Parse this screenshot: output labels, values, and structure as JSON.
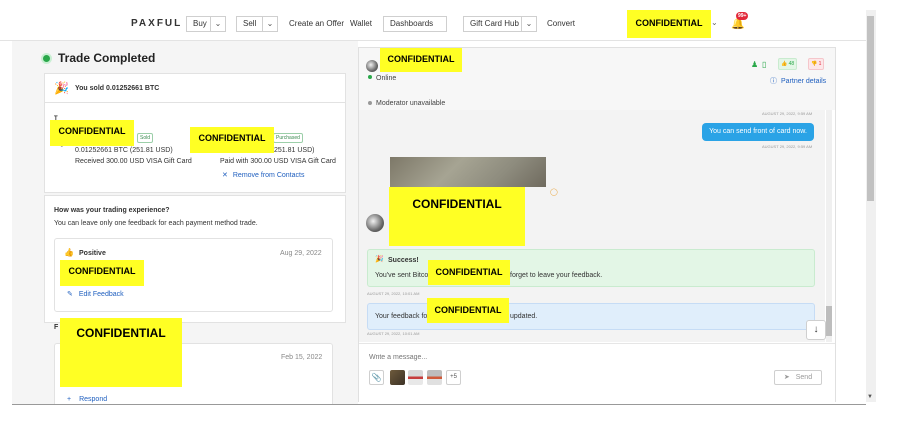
{
  "nav": {
    "logo": "PAXFUL",
    "buy": "Buy",
    "sell": "Sell",
    "create_offer": "Create an Offer",
    "wallet": "Wallet",
    "dashboards": "Dashboards",
    "gift_card_hub": "Gift Card Hub",
    "convert": "Convert",
    "user": "CONFIDENTIAL",
    "notif_count": "99+"
  },
  "left": {
    "title": "Trade Completed",
    "sold_line": "You sold 0.01252661 BTC",
    "redact_name1": "CONFIDENTIAL",
    "redact_name2": "CONFIDENTIAL",
    "sold_pill": "Sold",
    "purchased_pill": "Purchased",
    "sold_amount": "0.01252661 BTC  (251.81 USD)",
    "received": "Received 300.00 USD VISA Gift Card",
    "purchased_amount": "251.81 USD)",
    "paid_with": "Paid with 300.00 USD VISA Gift Card",
    "remove_contacts": "Remove from Contacts",
    "feedback_q": "How was your trading experience?",
    "feedback_note": "You can leave only one feedback for each payment method trade.",
    "positive": "Positive",
    "fb_date": "Aug 29, 2022",
    "redact_fb": "CONFIDENTIAL",
    "edit_feedback": "Edit Feedback",
    "section_f": "F",
    "redact_big": "CONFIDENTIAL",
    "fb_date2": "Feb 15, 2022",
    "respond": "Respond"
  },
  "chat": {
    "partner": "CONFIDENTIAL",
    "online": "Online",
    "moderator": "Moderator unavailable",
    "fb_pos": "48",
    "fb_neg": "1",
    "partner_details": "Partner details",
    "ts1": "AUGUST 29, 2022, 9:59 AM",
    "msg_out": "You can send front of card now.",
    "ts2": "AUGUST 29, 2022, 9:59 AM",
    "redact_img": "CONFIDENTIAL",
    "success_title": "Success!",
    "success_pre": "You've sent Bitco",
    "success_post": "forget to leave your feedback.",
    "redact_success": "CONFIDENTIAL",
    "ts3": "AUGUST 29, 2022, 10:01 AM",
    "info_pre": "Your feedback fo",
    "info_post": "updated.",
    "redact_info": "CONFIDENTIAL",
    "ts4": "AUGUST 29, 2022, 10:01 AM",
    "placeholder": "Write a message...",
    "plus_more": "+5",
    "send": "Send"
  },
  "colors": {
    "accent_green": "#2aa84a",
    "chat_blue": "#2aa3e6",
    "redaction": "#ffff24",
    "link_blue": "#1f5fbf"
  }
}
